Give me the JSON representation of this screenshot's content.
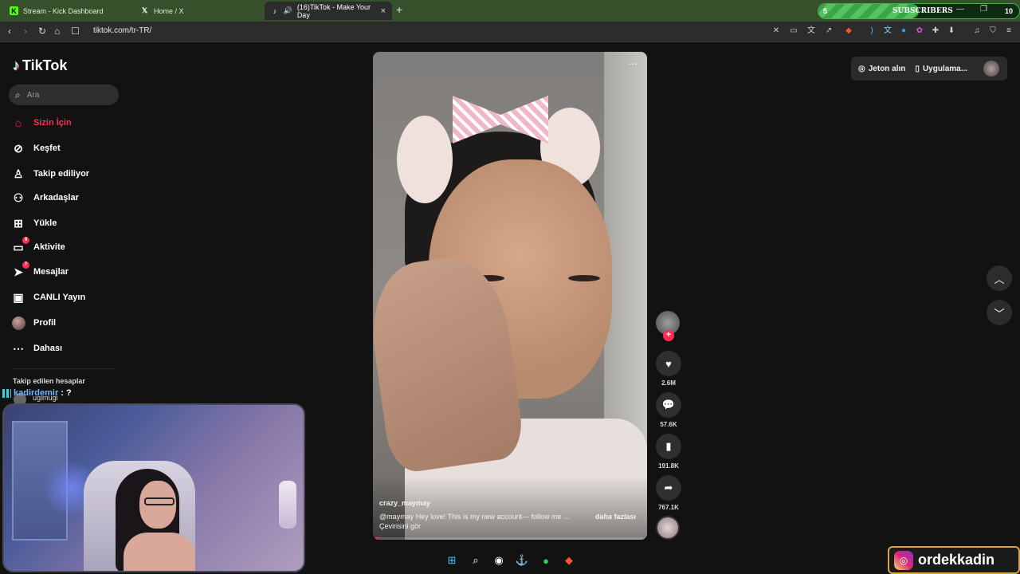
{
  "browser": {
    "tabs": [
      {
        "label": "Stream - Kick Dashboard",
        "icon": "kick-icon"
      },
      {
        "label": "Home / X",
        "icon": "x-icon"
      },
      {
        "label": "(16)TikTok - Make Your Day",
        "icon": "tiktok-icon"
      }
    ],
    "url": "tiktok.com/tr-TR/"
  },
  "subscribers_goal": {
    "start": "5",
    "label": "SUBSCRIBERS",
    "goal": "10"
  },
  "tiktok": {
    "logo_text": "TikTok",
    "search_placeholder": "Ara",
    "menu": [
      {
        "label": "Sizin İçin",
        "icon": "home-icon"
      },
      {
        "label": "Keşfet",
        "icon": "compass-icon"
      },
      {
        "label": "Takip ediliyor",
        "icon": "user-follow-icon"
      },
      {
        "label": "Arkadaşlar",
        "icon": "friends-icon"
      },
      {
        "label": "Yükle",
        "icon": "upload-icon"
      },
      {
        "label": "Aktivite",
        "icon": "activity-icon",
        "badge": "9"
      },
      {
        "label": "Mesajlar",
        "icon": "message-icon",
        "badge": "7"
      },
      {
        "label": "CANLI Yayın",
        "icon": "live-icon"
      },
      {
        "label": "Profil",
        "icon": "profile-avatar"
      },
      {
        "label": "Dahası",
        "icon": "more-dots-icon"
      }
    ],
    "followed_title": "Takip edilen hesaplar",
    "followed_account": "ugimugi",
    "top_buttons": {
      "coins": "Jeton alın",
      "app": "Uygulama..."
    },
    "video": {
      "author": "crazy_maymay",
      "caption": "@may̱may  Hey love! This is my new account— follow me ...",
      "more": "daha fazlası",
      "translate": "Çevirisini gör",
      "progress": 0.02
    },
    "actions": {
      "likes": "2.6M",
      "comments": "57.6K",
      "saves": "191.8K",
      "shares": "767.1K"
    }
  },
  "chat": {
    "user": "kadirdemir",
    "message": ": ?"
  },
  "overlay": {
    "brand": "ordekkadin"
  }
}
